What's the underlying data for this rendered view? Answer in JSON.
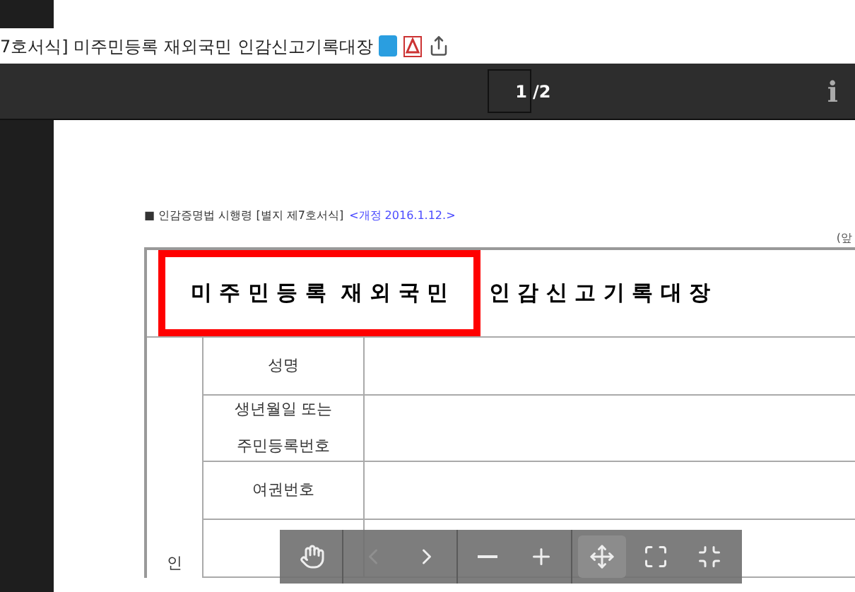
{
  "title": "7호서식] 미주민등록 재외국민 인감신고기록대장",
  "title_icons": [
    {
      "kind": "hwp"
    },
    {
      "kind": "pdf"
    },
    {
      "kind": "share"
    }
  ],
  "viewer_toolbar": {
    "page_current": "1",
    "page_total": "/2",
    "info": "i"
  },
  "document": {
    "note": "■ 인감증명법 시행령 [별지 제7호서식]",
    "revision": "<개정 2016.1.12.>",
    "side_note": "(앞",
    "form_title": [
      {
        "text": "미 주 민 등 록  재 외 국 민",
        "highlighted": true
      },
      {
        "text": "인 감 신 고 기 록 대 장",
        "highlighted": false
      }
    ],
    "section_label": "인",
    "rows": [
      {
        "label": [
          "성명"
        ]
      },
      {
        "label": [
          "생년월일 또는",
          "주민등록번호"
        ]
      },
      {
        "label": [
          "여권번호"
        ]
      },
      {
        "label": []
      }
    ]
  },
  "floating_toolbar": [
    {
      "kind": "hand",
      "disabled": false,
      "selected": false
    },
    {
      "kind": "prev",
      "disabled": true,
      "selected": false
    },
    {
      "kind": "next",
      "disabled": false,
      "selected": false
    },
    {
      "kind": "zoom_out",
      "disabled": false,
      "selected": false
    },
    {
      "kind": "zoom_in",
      "disabled": false,
      "selected": false
    },
    {
      "kind": "fit",
      "disabled": false,
      "selected": true
    },
    {
      "kind": "fullscreen",
      "disabled": false,
      "selected": false
    },
    {
      "kind": "exit_fullscreen",
      "disabled": false,
      "selected": false
    }
  ]
}
